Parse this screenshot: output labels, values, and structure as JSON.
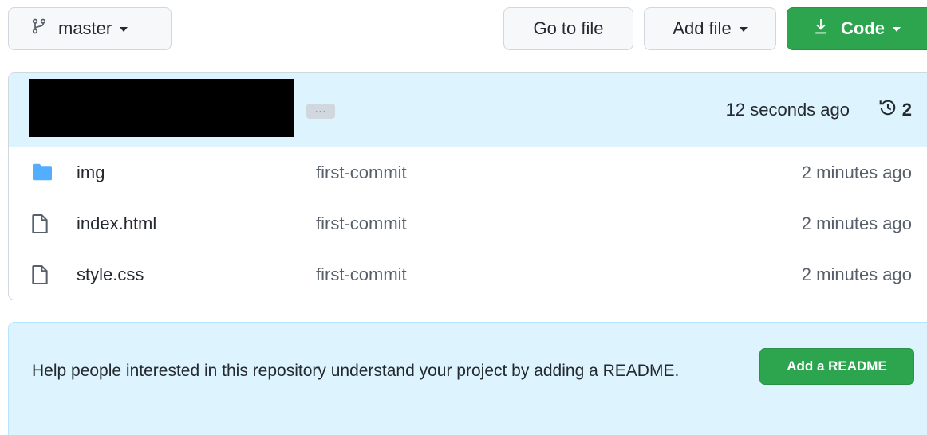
{
  "toolbar": {
    "branch_label": "master",
    "goto_label": "Go to file",
    "addfile_label": "Add file",
    "code_label": "Code",
    "code_color": "#2da44e"
  },
  "commit": {
    "ellipsis": "...",
    "time": "12 seconds ago",
    "history_count": "2"
  },
  "files": [
    {
      "icon": "folder-icon",
      "name": "img",
      "message": "first-commit",
      "time": "2 minutes ago"
    },
    {
      "icon": "file-icon",
      "name": "index.html",
      "message": "first-commit",
      "time": "2 minutes ago"
    },
    {
      "icon": "file-icon",
      "name": "style.css",
      "message": "first-commit",
      "time": "2 minutes ago"
    }
  ],
  "readme": {
    "text": "Help people interested in this repository understand your project by adding a README.",
    "button_label": "Add a README"
  }
}
